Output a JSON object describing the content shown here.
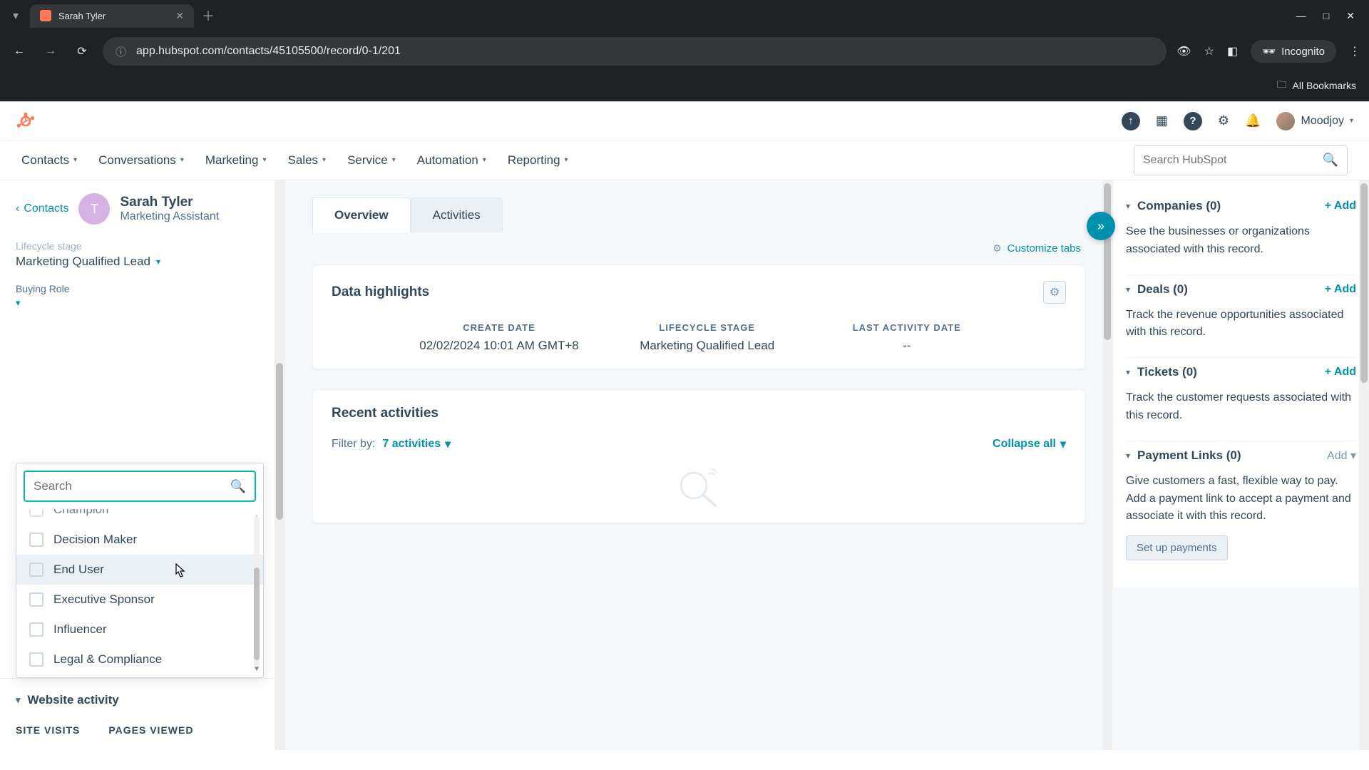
{
  "browser": {
    "tab_title": "Sarah Tyler",
    "url": "app.hubspot.com/contacts/45105500/record/0-1/201",
    "incognito_label": "Incognito",
    "all_bookmarks": "All Bookmarks"
  },
  "app_header": {
    "user_name": "Moodjoy",
    "search_placeholder": "Search HubSpot"
  },
  "nav": {
    "items": [
      "Contacts",
      "Conversations",
      "Marketing",
      "Sales",
      "Service",
      "Automation",
      "Reporting"
    ]
  },
  "left": {
    "back_label": "Contacts",
    "avatar_initial": "T",
    "name": "Sarah Tyler",
    "subtitle": "Marketing Assistant",
    "lifecycle_label_trunc": "Lifecycle stage",
    "lifecycle_value": "Marketing Qualified Lead",
    "buying_role_label": "Buying Role",
    "dropdown": {
      "search_placeholder": "Search",
      "options": [
        "Champion",
        "Decision Maker",
        "End User",
        "Executive Sponsor",
        "Influencer",
        "Legal & Compliance"
      ],
      "hover_index": 2
    },
    "website_activity": {
      "title": "Website activity",
      "tabs": [
        "SITE VISITS",
        "PAGES VIEWED"
      ]
    }
  },
  "mid": {
    "tabs": {
      "overview": "Overview",
      "activities": "Activities"
    },
    "customize_label": "Customize tabs",
    "data_highlights": {
      "title": "Data highlights",
      "items": [
        {
          "label": "CREATE DATE",
          "value": "02/02/2024 10:01 AM GMT+8"
        },
        {
          "label": "LIFECYCLE STAGE",
          "value": "Marketing Qualified Lead"
        },
        {
          "label": "LAST ACTIVITY DATE",
          "value": "--"
        }
      ]
    },
    "recent": {
      "title": "Recent activities",
      "filter_label": "Filter by:",
      "filter_value": "7 activities",
      "collapse_label": "Collapse all"
    }
  },
  "right": {
    "sections": [
      {
        "title": "Companies (0)",
        "add": "+ Add",
        "body": "See the businesses or organizations associated with this record."
      },
      {
        "title": "Deals (0)",
        "add": "+ Add",
        "body": "Track the revenue opportunities associated with this record."
      },
      {
        "title": "Tickets (0)",
        "add": "+ Add",
        "body": "Track the customer requests associated with this record."
      },
      {
        "title": "Payment Links (0)",
        "add": "Add",
        "body": "Give customers a fast, flexible way to pay. Add a payment link to accept a payment and associate it with this record.",
        "button": "Set up payments"
      }
    ]
  }
}
